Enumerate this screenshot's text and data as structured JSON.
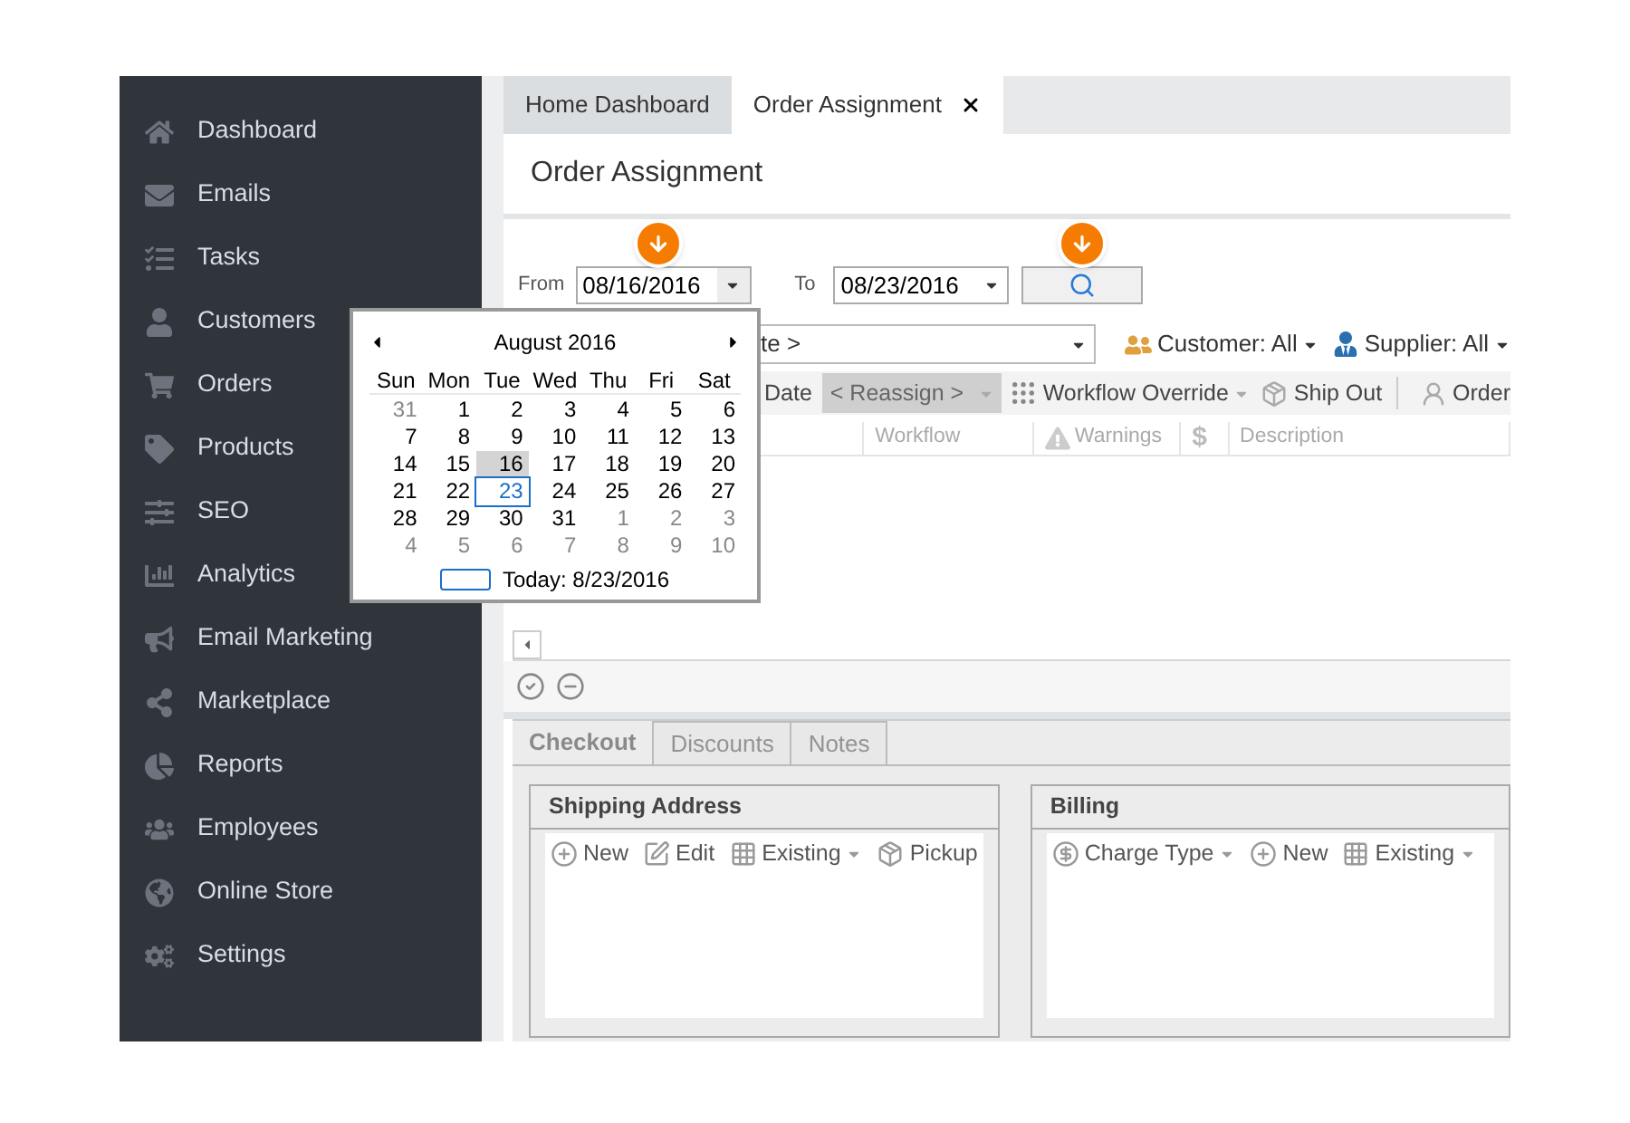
{
  "sidebar": {
    "items": [
      {
        "label": "Dashboard"
      },
      {
        "label": "Emails"
      },
      {
        "label": "Tasks"
      },
      {
        "label": "Customers"
      },
      {
        "label": "Orders"
      },
      {
        "label": "Products"
      },
      {
        "label": "SEO"
      },
      {
        "label": "Analytics"
      },
      {
        "label": "Email Marketing"
      },
      {
        "label": "Marketplace"
      },
      {
        "label": "Reports"
      },
      {
        "label": "Employees"
      },
      {
        "label": "Online Store"
      },
      {
        "label": "Settings"
      }
    ]
  },
  "tabs": [
    {
      "label": "Home Dashboard",
      "selected": false,
      "closable": false
    },
    {
      "label": "Order Assignment",
      "selected": true,
      "closable": true
    }
  ],
  "page_title": "Order Assignment",
  "filter": {
    "from_label": "From",
    "from_value": "08/16/2016",
    "to_label": "To",
    "to_value": "08/23/2016"
  },
  "calendar": {
    "month_title": "August 2016",
    "weekdays": [
      "Sun",
      "Mon",
      "Tue",
      "Wed",
      "Thu",
      "Fri",
      "Sat"
    ],
    "weeks": [
      [
        {
          "day": "31",
          "in_month": false,
          "selected": false,
          "today": false
        },
        {
          "day": "1",
          "in_month": true,
          "selected": false,
          "today": false
        },
        {
          "day": "2",
          "in_month": true,
          "selected": false,
          "today": false
        },
        {
          "day": "3",
          "in_month": true,
          "selected": false,
          "today": false
        },
        {
          "day": "4",
          "in_month": true,
          "selected": false,
          "today": false
        },
        {
          "day": "5",
          "in_month": true,
          "selected": false,
          "today": false
        },
        {
          "day": "6",
          "in_month": true,
          "selected": false,
          "today": false
        }
      ],
      [
        {
          "day": "7",
          "in_month": true,
          "selected": false,
          "today": false
        },
        {
          "day": "8",
          "in_month": true,
          "selected": false,
          "today": false
        },
        {
          "day": "9",
          "in_month": true,
          "selected": false,
          "today": false
        },
        {
          "day": "10",
          "in_month": true,
          "selected": false,
          "today": false
        },
        {
          "day": "11",
          "in_month": true,
          "selected": false,
          "today": false
        },
        {
          "day": "12",
          "in_month": true,
          "selected": false,
          "today": false
        },
        {
          "day": "13",
          "in_month": true,
          "selected": false,
          "today": false
        }
      ],
      [
        {
          "day": "14",
          "in_month": true,
          "selected": false,
          "today": false
        },
        {
          "day": "15",
          "in_month": true,
          "selected": false,
          "today": false
        },
        {
          "day": "16",
          "in_month": true,
          "selected": true,
          "today": false
        },
        {
          "day": "17",
          "in_month": true,
          "selected": false,
          "today": false
        },
        {
          "day": "18",
          "in_month": true,
          "selected": false,
          "today": false
        },
        {
          "day": "19",
          "in_month": true,
          "selected": false,
          "today": false
        },
        {
          "day": "20",
          "in_month": true,
          "selected": false,
          "today": false
        }
      ],
      [
        {
          "day": "21",
          "in_month": true,
          "selected": false,
          "today": false
        },
        {
          "day": "22",
          "in_month": true,
          "selected": false,
          "today": false
        },
        {
          "day": "23",
          "in_month": true,
          "selected": false,
          "today": true
        },
        {
          "day": "24",
          "in_month": true,
          "selected": false,
          "today": false
        },
        {
          "day": "25",
          "in_month": true,
          "selected": false,
          "today": false
        },
        {
          "day": "26",
          "in_month": true,
          "selected": false,
          "today": false
        },
        {
          "day": "27",
          "in_month": true,
          "selected": false,
          "today": false
        }
      ],
      [
        {
          "day": "28",
          "in_month": true,
          "selected": false,
          "today": false
        },
        {
          "day": "29",
          "in_month": true,
          "selected": false,
          "today": false
        },
        {
          "day": "30",
          "in_month": true,
          "selected": false,
          "today": false
        },
        {
          "day": "31",
          "in_month": true,
          "selected": false,
          "today": false
        },
        {
          "day": "1",
          "in_month": false,
          "selected": false,
          "today": false
        },
        {
          "day": "2",
          "in_month": false,
          "selected": false,
          "today": false
        },
        {
          "day": "3",
          "in_month": false,
          "selected": false,
          "today": false
        }
      ],
      [
        {
          "day": "4",
          "in_month": false,
          "selected": false,
          "today": false
        },
        {
          "day": "5",
          "in_month": false,
          "selected": false,
          "today": false
        },
        {
          "day": "6",
          "in_month": false,
          "selected": false,
          "today": false
        },
        {
          "day": "7",
          "in_month": false,
          "selected": false,
          "today": false
        },
        {
          "day": "8",
          "in_month": false,
          "selected": false,
          "today": false
        },
        {
          "day": "9",
          "in_month": false,
          "selected": false,
          "today": false
        },
        {
          "day": "10",
          "in_month": false,
          "selected": false,
          "today": false
        }
      ]
    ],
    "today_text": "Today: 8/23/2016"
  },
  "scope_row": {
    "scope_value": "te >",
    "customer": "Customer: All",
    "supplier": "Supplier: All"
  },
  "toolbar": [
    {
      "kind": "text",
      "label": "Date",
      "disabled": false
    },
    {
      "kind": "dropdown",
      "label": "< Reassign >",
      "disabled": true
    },
    {
      "kind": "workflow",
      "label": "Workflow Override",
      "disabled": false
    },
    {
      "kind": "ship",
      "label": "Ship Out",
      "disabled": false
    },
    {
      "kind": "order",
      "label": "Order",
      "disabled": false
    }
  ],
  "columns": [
    {
      "kind": "blank"
    },
    {
      "kind": "text",
      "label": "Workflow"
    },
    {
      "kind": "warning",
      "label": "Warnings"
    },
    {
      "kind": "text",
      "label": "$"
    },
    {
      "kind": "text",
      "label": "Description"
    }
  ],
  "bottom_tabs": [
    {
      "label": "Checkout",
      "selected": true
    },
    {
      "label": "Discounts",
      "selected": false
    },
    {
      "label": "Notes",
      "selected": false
    }
  ],
  "groups": [
    {
      "title": "Shipping Address",
      "tools": [
        {
          "kind": "new",
          "label": "New"
        },
        {
          "kind": "edit",
          "label": "Edit"
        },
        {
          "kind": "existing",
          "label": "Existing"
        },
        {
          "kind": "pickup",
          "label": "Pickup"
        }
      ]
    },
    {
      "title": "Billing",
      "tools": [
        {
          "kind": "charge",
          "label": "Charge Type"
        },
        {
          "kind": "new",
          "label": "New"
        },
        {
          "kind": "existing",
          "label": "Existing"
        }
      ]
    }
  ]
}
